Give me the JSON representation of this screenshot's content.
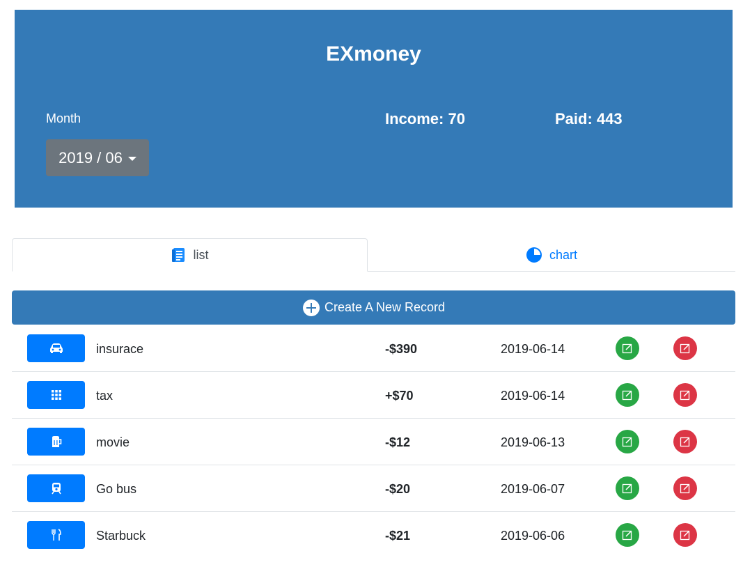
{
  "app": {
    "title": "EXmoney",
    "month_label": "Month",
    "month_value": "2019 / 06",
    "income_label": "Income: 70",
    "paid_label": "Paid: 443"
  },
  "tabs": [
    {
      "label": "list",
      "icon": "list-icon",
      "active": true
    },
    {
      "label": "chart",
      "icon": "pie-chart-icon",
      "active": false
    }
  ],
  "create_button": {
    "label": "Create A New Record",
    "icon": "plus-circle-icon"
  },
  "records": [
    {
      "icon": "car-icon",
      "title": "insurace",
      "amount": "-$390",
      "date": "2019-06-14"
    },
    {
      "icon": "apps-icon",
      "title": "tax",
      "amount": "+$70",
      "date": "2019-06-14"
    },
    {
      "icon": "beer-icon",
      "title": "movie",
      "amount": "-$12",
      "date": "2019-06-13"
    },
    {
      "icon": "train-icon",
      "title": "Go bus",
      "amount": "-$20",
      "date": "2019-06-07"
    },
    {
      "icon": "restaurant-icon",
      "title": "Starbuck",
      "amount": "-$21",
      "date": "2019-06-06"
    }
  ],
  "colors": {
    "header_bg": "#347ab7",
    "primary": "#007bff",
    "edit": "#28a745",
    "delete": "#dc3545",
    "month_button": "#6c757d"
  }
}
